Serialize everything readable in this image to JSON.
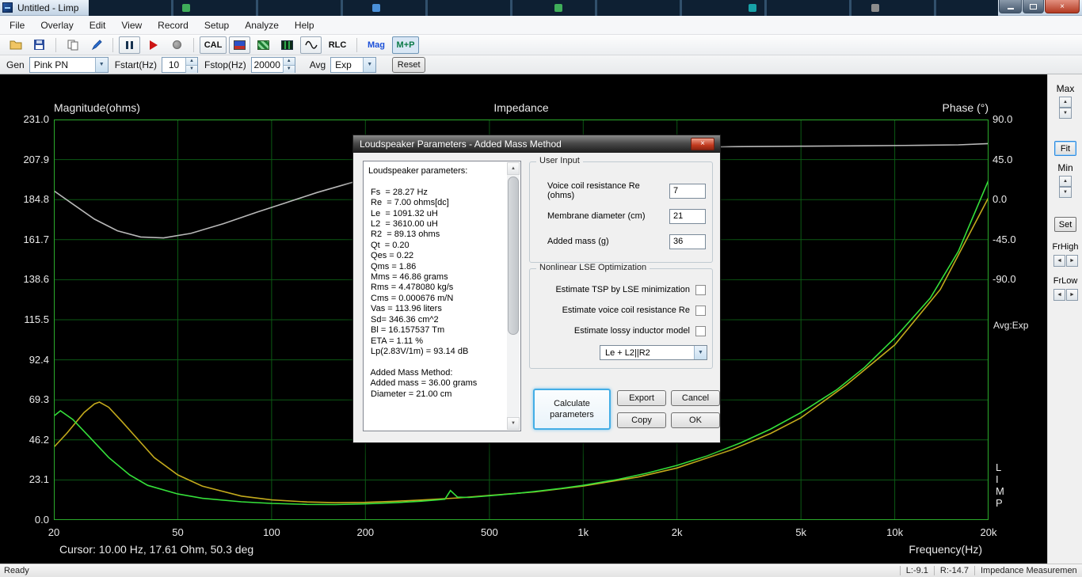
{
  "window": {
    "title": "Untitled - Limp",
    "close_glyph": "×"
  },
  "menu": {
    "items": [
      "File",
      "Overlay",
      "Edit",
      "View",
      "Record",
      "Setup",
      "Analyze",
      "Help"
    ]
  },
  "toolbar": {
    "cal": "CAL",
    "rlc": "RLC",
    "mag": "Mag",
    "mp": "M+P"
  },
  "controls_bar": {
    "gen_label": "Gen",
    "gen_value": "Pink PN",
    "fstart_label": "Fstart(Hz)",
    "fstart_value": "10",
    "fstop_label": "Fstop(Hz)",
    "fstop_value": "20000",
    "avg_label": "Avg",
    "avg_value": "Exp",
    "reset": "Reset"
  },
  "right_panel": {
    "max": "Max",
    "fit": "Fit",
    "min": "Min",
    "set": "Set",
    "frhigh": "FrHigh",
    "frlow": "FrLow"
  },
  "side_annotations": {
    "avg_mode": "Avg:Exp",
    "limp_letters": [
      "L",
      "I",
      "M",
      "P"
    ]
  },
  "chart_data": {
    "type": "line",
    "title": "Impedance",
    "background": "#000000",
    "grid_color": "#0c5a14",
    "border_color": "#2baa2b",
    "x_axis": {
      "label": "Frequency(Hz)",
      "scale": "log",
      "range": [
        20,
        20000
      ],
      "ticks": [
        {
          "f": 20,
          "label": "20"
        },
        {
          "f": 50,
          "label": "50"
        },
        {
          "f": 100,
          "label": "100"
        },
        {
          "f": 200,
          "label": "200"
        },
        {
          "f": 500,
          "label": "500"
        },
        {
          "f": 1000,
          "label": "1k"
        },
        {
          "f": 2000,
          "label": "2k"
        },
        {
          "f": 5000,
          "label": "5k"
        },
        {
          "f": 10000,
          "label": "10k"
        },
        {
          "f": 20000,
          "label": "20k"
        }
      ]
    },
    "y_left": {
      "label": "Magnitude(ohms)",
      "range": [
        0,
        231
      ],
      "ticks": [
        "231.0",
        "207.9",
        "184.8",
        "161.7",
        "138.6",
        "115.5",
        "92.4",
        "69.3",
        "46.2",
        "23.1",
        "0.0"
      ]
    },
    "y_right": {
      "label": "Phase (°)",
      "range_top": 90,
      "deg_per_div": 45,
      "ticks": [
        "90.0",
        "45.0",
        "0.0",
        "-45.0",
        "-90.0"
      ]
    },
    "cursor_text": "Cursor: 10.00 Hz, 17.61 Ohm, 50.3 deg",
    "series": [
      {
        "name": "impedance-magnitude-current",
        "color": "#35e03a",
        "axis": "mag",
        "points": [
          [
            20,
            60
          ],
          [
            21,
            63
          ],
          [
            23,
            58
          ],
          [
            26,
            48
          ],
          [
            30,
            36
          ],
          [
            35,
            26
          ],
          [
            40,
            20
          ],
          [
            50,
            15
          ],
          [
            60,
            12.5
          ],
          [
            80,
            10.5
          ],
          [
            100,
            9.6
          ],
          [
            130,
            9.0
          ],
          [
            160,
            8.9
          ],
          [
            200,
            9.3
          ],
          [
            250,
            10.0
          ],
          [
            300,
            10.8
          ],
          [
            340,
            11.6
          ],
          [
            360,
            12.0
          ],
          [
            375,
            17.0
          ],
          [
            395,
            13.2
          ],
          [
            430,
            13.0
          ],
          [
            500,
            14.0
          ],
          [
            600,
            15.2
          ],
          [
            700,
            16.5
          ],
          [
            850,
            18.2
          ],
          [
            1000,
            20.0
          ],
          [
            1300,
            23.5
          ],
          [
            1600,
            27.0
          ],
          [
            2000,
            31.5
          ],
          [
            2500,
            37.0
          ],
          [
            3200,
            44.5
          ],
          [
            4000,
            52.5
          ],
          [
            5000,
            62.0
          ],
          [
            6500,
            75.0
          ],
          [
            8000,
            88.0
          ],
          [
            10000,
            105.0
          ],
          [
            13000,
            128.0
          ],
          [
            16000,
            155.0
          ],
          [
            20000,
            196.0
          ]
        ]
      },
      {
        "name": "impedance-magnitude-overlay",
        "color": "#c3aa1c",
        "axis": "mag",
        "points": [
          [
            20,
            42
          ],
          [
            22,
            50
          ],
          [
            25,
            62
          ],
          [
            27,
            67
          ],
          [
            28,
            68
          ],
          [
            30,
            65
          ],
          [
            33,
            57
          ],
          [
            37,
            47
          ],
          [
            42,
            36
          ],
          [
            50,
            26
          ],
          [
            60,
            19.5
          ],
          [
            80,
            13.8
          ],
          [
            100,
            11.6
          ],
          [
            130,
            10.4
          ],
          [
            160,
            10.0
          ],
          [
            200,
            10.2
          ],
          [
            250,
            10.8
          ],
          [
            300,
            11.5
          ],
          [
            400,
            12.8
          ],
          [
            500,
            14.2
          ],
          [
            700,
            16.2
          ],
          [
            1000,
            19.6
          ],
          [
            1500,
            24.8
          ],
          [
            2000,
            30.0
          ],
          [
            3000,
            40.5
          ],
          [
            4000,
            50.0
          ],
          [
            5000,
            59.0
          ],
          [
            7000,
            78.0
          ],
          [
            10000,
            101.0
          ],
          [
            14000,
            133.0
          ],
          [
            20000,
            186.0
          ]
        ]
      },
      {
        "name": "impedance-phase",
        "color": "#b8b8b8",
        "axis": "phase",
        "points": [
          [
            20,
            10
          ],
          [
            23,
            -5
          ],
          [
            27,
            -22
          ],
          [
            32,
            -35
          ],
          [
            38,
            -42
          ],
          [
            45,
            -43
          ],
          [
            55,
            -38
          ],
          [
            70,
            -27
          ],
          [
            90,
            -14
          ],
          [
            110,
            -4
          ],
          [
            140,
            8
          ],
          [
            180,
            19
          ],
          [
            230,
            28
          ],
          [
            300,
            36
          ],
          [
            400,
            43
          ],
          [
            500,
            47
          ],
          [
            700,
            52
          ],
          [
            1000,
            55
          ],
          [
            1500,
            57.5
          ],
          [
            2000,
            58.5
          ],
          [
            3000,
            59.5
          ],
          [
            5000,
            60
          ],
          [
            8000,
            60.5
          ],
          [
            12000,
            61
          ],
          [
            16000,
            61.5
          ],
          [
            20000,
            63
          ]
        ]
      }
    ]
  },
  "dialog": {
    "title": "Loudspeaker Parameters - Added Mass Method",
    "close_glyph": "×",
    "results_text": "Loudspeaker parameters:\n\n Fs  = 28.27 Hz\n Re  = 7.00 ohms[dc]\n Le  = 1091.32 uH\n L2  = 3610.00 uH\n R2  = 89.13 ohms\n Qt  = 0.20\n Qes = 0.22\n Qms = 1.86\n Mms = 46.86 grams\n Rms = 4.478080 kg/s\n Cms = 0.000676 m/N\n Vas = 113.96 liters\n Sd= 346.36 cm^2\n Bl = 16.157537 Tm\n ETA = 1.11 %\n Lp(2.83V/1m) = 93.14 dB\n\n Added Mass Method:\n Added mass = 36.00 grams\n Diameter = 21.00 cm",
    "user_input": {
      "group_label": "User Input",
      "fields": [
        {
          "label": "Voice coil resistance Re (ohms)",
          "value": "7"
        },
        {
          "label": "Membrane diameter (cm)",
          "value": "21"
        },
        {
          "label": "Added mass (g)",
          "value": "36"
        }
      ]
    },
    "lse": {
      "group_label": "Nonlinear LSE Optimization",
      "checkboxes": [
        {
          "label": "Estimate TSP by LSE minimization",
          "checked": false
        },
        {
          "label": "Estimate voice coil resistance Re",
          "checked": false
        },
        {
          "label": "Estimate lossy inductor model",
          "checked": false
        }
      ],
      "inductor_model": "Le + L2||R2"
    },
    "buttons": {
      "calculate": "Calculate parameters",
      "export": "Export",
      "cancel": "Cancel",
      "copy": "Copy",
      "ok": "OK"
    }
  },
  "status_bar": {
    "ready": "Ready",
    "left_level": "L:-9.1",
    "right_level": "R:-14.7",
    "mode": "Impedance Measuremen"
  }
}
